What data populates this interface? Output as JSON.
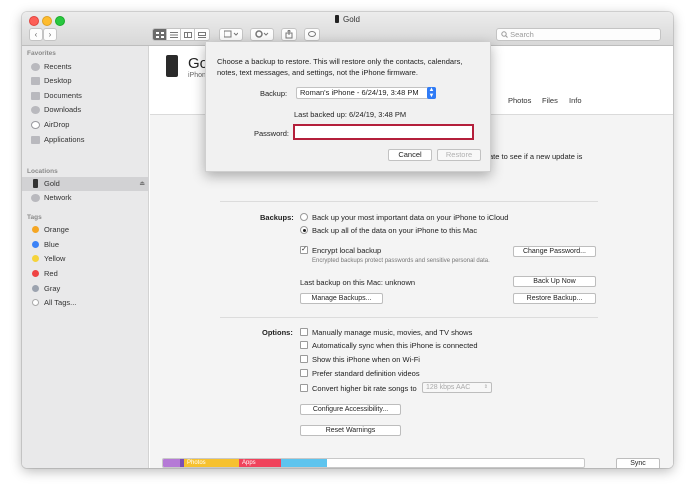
{
  "window": {
    "title": "Gold"
  },
  "toolbar": {
    "back": "‹",
    "forward": "›",
    "search_placeholder": "Search"
  },
  "sidebar": {
    "favorites_header": "Favorites",
    "favorites": [
      {
        "label": "Recents",
        "icon": "clock-icon"
      },
      {
        "label": "Desktop",
        "icon": "desktop-icon"
      },
      {
        "label": "Documents",
        "icon": "document-icon"
      },
      {
        "label": "Downloads",
        "icon": "download-icon"
      },
      {
        "label": "AirDrop",
        "icon": "airdrop-icon"
      },
      {
        "label": "Applications",
        "icon": "applications-icon"
      }
    ],
    "locations_header": "Locations",
    "locations": [
      {
        "label": "Gold",
        "icon": "iphone-icon",
        "selected": true,
        "eject": "⏏"
      },
      {
        "label": "Network",
        "icon": "globe-icon"
      }
    ],
    "tags_header": "Tags",
    "tags": [
      {
        "label": "Orange",
        "color": "#f5a623"
      },
      {
        "label": "Blue",
        "color": "#3b82f6"
      },
      {
        "label": "Yellow",
        "color": "#f5d33a"
      },
      {
        "label": "Red",
        "color": "#ef4444"
      },
      {
        "label": "Gray",
        "color": "#9ca3af"
      },
      {
        "label": "All Tags...",
        "color": "#cfcfcf"
      }
    ]
  },
  "device": {
    "name": "Gold",
    "subtitle": "iPhone"
  },
  "tabs": {
    "partial": "ks",
    "photos": "Photos",
    "files": "Files",
    "info": "Info"
  },
  "update_text": "ate to see if a new update is",
  "backups": {
    "label": "Backups:",
    "icloud_option": "Back up your most important data on your iPhone to iCloud",
    "mac_option": "Back up all of the data on your iPhone to this Mac",
    "encrypt_label": "Encrypt local backup",
    "encrypt_note": "Encrypted backups protect passwords and sensitive personal data.",
    "change_password": "Change Password...",
    "last_backup": "Last backup on this Mac: unknown",
    "back_up_now": "Back Up Now",
    "manage_backups": "Manage Backups...",
    "restore_backup": "Restore Backup..."
  },
  "options": {
    "label": "Options:",
    "items": [
      "Manually manage music, movies, and TV shows",
      "Automatically sync when this iPhone is connected",
      "Show this iPhone when on Wi-Fi",
      "Prefer standard definition videos",
      "Convert higher bit rate songs to"
    ],
    "bitrate": "128 kbps AAC",
    "configure_accessibility": "Configure Accessibility...",
    "reset_warnings": "Reset Warnings"
  },
  "storage": {
    "segments": [
      {
        "label": "",
        "color": "#b57ad6",
        "share": 0.04
      },
      {
        "label": "",
        "color": "#7a4fb3",
        "share": 0.01
      },
      {
        "label": "Photos",
        "color": "#f6c12f",
        "share": 0.13
      },
      {
        "label": "Apps",
        "color": "#f0435c",
        "share": 0.1
      },
      {
        "label": "",
        "color": "#5ec4ee",
        "share": 0.11
      }
    ]
  },
  "sync_button": "Sync",
  "dialog": {
    "message": "Choose a backup to restore. This will restore only the contacts, calendars, notes, text messages, and settings, not the iPhone firmware.",
    "backup_label": "Backup:",
    "backup_value": "Roman's iPhone - 6/24/19, 3:48 PM",
    "last_backed_up": "Last backed up:  6/24/19, 3:48 PM",
    "password_label": "Password:",
    "password_value": "",
    "cancel": "Cancel",
    "restore": "Restore"
  }
}
